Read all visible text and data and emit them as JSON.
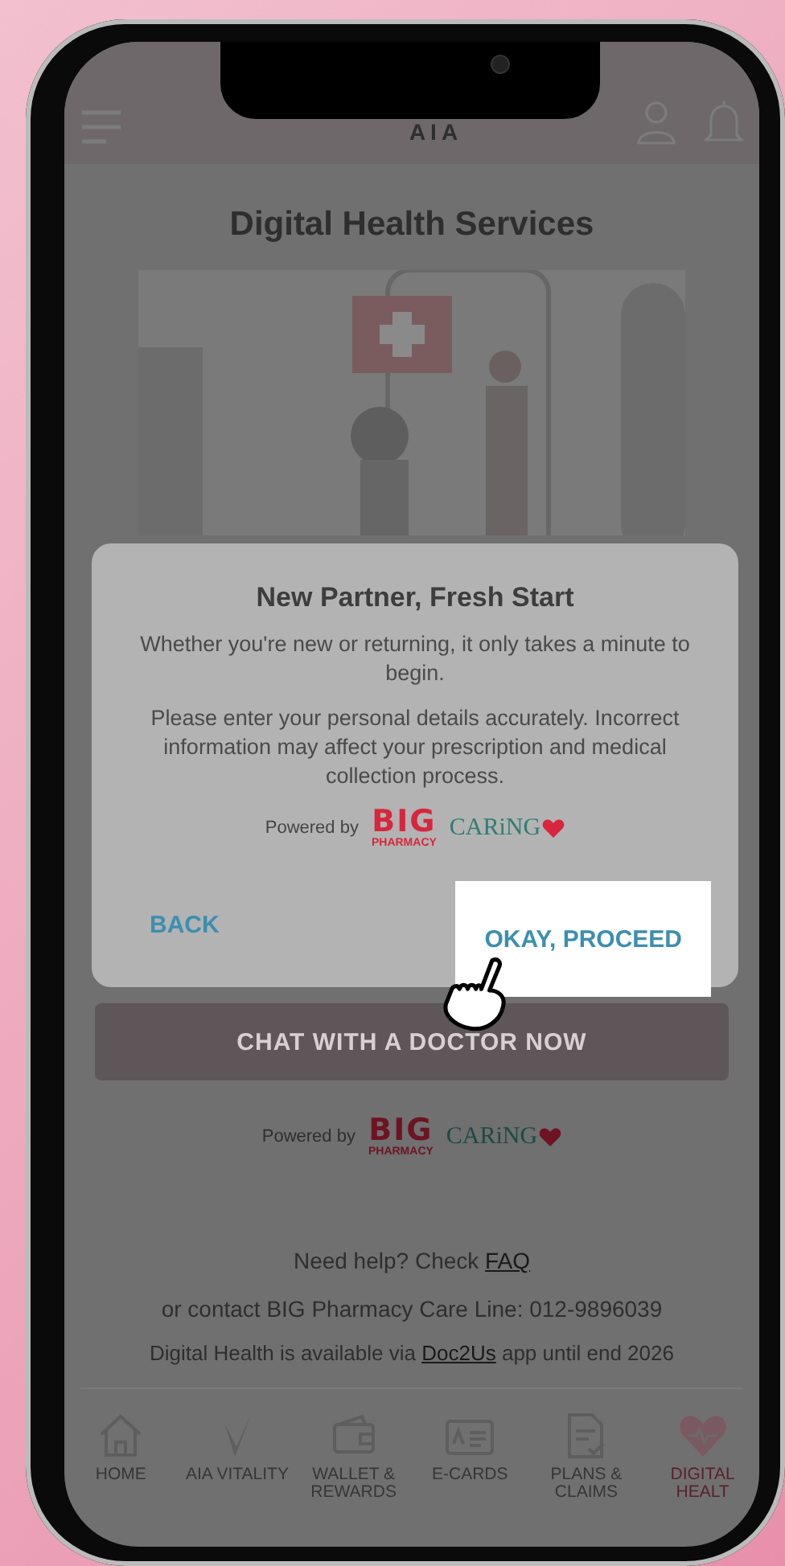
{
  "header": {
    "logo": "AIA"
  },
  "page": {
    "title": "Digital Health Services",
    "chat_button": "CHAT WITH A DOCTOR NOW",
    "powered_by": "Powered by",
    "big_logo": {
      "name": "BIG",
      "sub": "PHARMACY"
    },
    "caring_logo": "CARiNG",
    "help": {
      "text": "Need help? Check",
      "link": "FAQ"
    },
    "contact": "or contact BIG Pharmacy Care Line:  012-9896039",
    "availability": {
      "before": "Digital Health is available via ",
      "link": "Doc2Us",
      "after": " app until end 2026"
    }
  },
  "nav": [
    {
      "label": "HOME",
      "selected": false
    },
    {
      "label": "AIA VITALITY",
      "selected": false
    },
    {
      "label": "WALLET & REWARDS",
      "selected": false
    },
    {
      "label": "E-CARDS",
      "selected": false
    },
    {
      "label": "PLANS & CLAIMS",
      "selected": false
    },
    {
      "label": "DIGITAL HEALT",
      "selected": true
    }
  ],
  "dialog": {
    "title": "New Partner, Fresh Start",
    "paragraphs": [
      "Whether you're new or returning, it only takes a minute to begin.",
      "Please enter your personal details accurately. Incorrect information may affect your prescription and medical collection process."
    ],
    "powered_by": "Powered by",
    "big_logo": {
      "name": "BIG",
      "sub": "PHARMACY"
    },
    "caring_logo": "CARiNG",
    "buttons": [
      {
        "label": "BACK",
        "highlighted": false
      },
      {
        "label": "OKAY, PROCEED",
        "highlighted": true
      }
    ]
  }
}
